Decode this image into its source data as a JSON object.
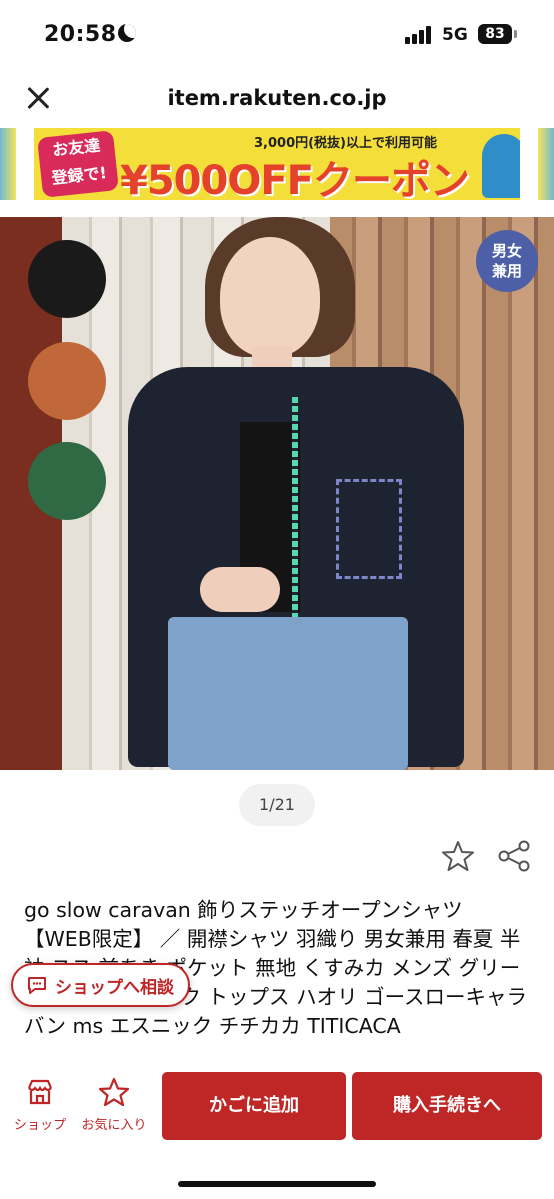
{
  "status_bar": {
    "time": "20:58",
    "network": "5G",
    "battery": "83"
  },
  "nav": {
    "url": "item.rakuten.co.jp"
  },
  "banner": {
    "friend_label": "お友達\n登録で!",
    "condition": "3,000円(税抜)以上で利用可能",
    "coupon": "¥500OFFクーポン"
  },
  "product": {
    "unisex_badge": "男女\n兼用",
    "page_counter": "1/21",
    "title": "go slow caravan 飾りステッチオープンシャツ 【WEB限定】 ／ 開襟シャツ 羽織り 男女兼用 春夏 半袖 スス 前あき ポケット 無地 くすみカ メンズ グリーン ブラック ピンク トップス ハオリ ゴースローキャラバン ms エスニック チチカカ TITICACA",
    "swatches": [
      {
        "name": "black",
        "color": "#1a1a1a"
      },
      {
        "name": "orange",
        "color": "#c0683a"
      },
      {
        "name": "green",
        "color": "#2f6a45"
      }
    ]
  },
  "chat_button": {
    "label": "ショップへ相談"
  },
  "bottom_bar": {
    "shop_label": "ショップ",
    "favorite_label": "お気に入り",
    "cart_label": "かごに追加",
    "buy_label": "購入手続きへ"
  },
  "colors": {
    "accent": "#bf2626"
  }
}
